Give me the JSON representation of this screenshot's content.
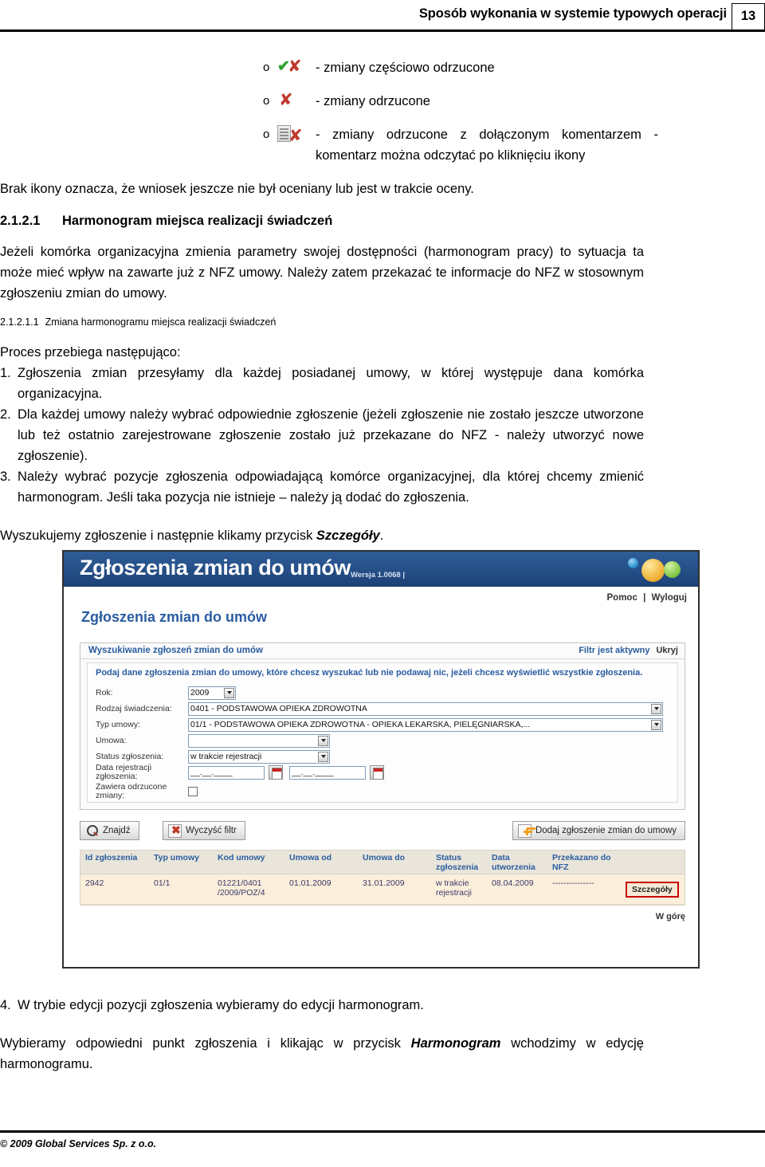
{
  "header": {
    "title": "Sposób wykonania w systemie typowych operacji",
    "page_number": "13"
  },
  "icon_list": [
    {
      "bullet": "o",
      "icon": "check-and-red-x-icon",
      "text": "- zmiany częściowo odrzucone"
    },
    {
      "bullet": "o",
      "icon": "red-x-icon",
      "text": "- zmiany odrzucone"
    },
    {
      "bullet": "o",
      "icon": "document-with-red-x-icon",
      "text": "- zmiany odrzucone z dołączonym komentarzem - komentarz można odczytać po kliknięciu ikony"
    }
  ],
  "note": "Brak ikony oznacza, że wniosek jeszcze nie był oceniany lub jest w trakcie oceny.",
  "section": {
    "number": "2.1.2.1",
    "title": "Harmonogram miejsca realizacji świadczeń",
    "paragraph": "Jeżeli komórka organizacyjna zmienia parametry swojej dostępności (harmonogram pracy) to sytuacja ta może mieć wpływ na zawarte już z NFZ umowy. Należy zatem przekazać te informacje do NFZ w stosownym zgłoszeniu zmian do umowy."
  },
  "subsection": {
    "number": "2.1.2.1.1",
    "title": "Zmiana harmonogramu miejsca realizacji świadczeń"
  },
  "process": {
    "intro": "Proces przebiega następująco:",
    "steps": [
      {
        "n": "1.",
        "text": "Zgłoszenia zmian przesyłamy dla każdej posiadanej umowy, w której występuje dana komórka organizacyjna."
      },
      {
        "n": "2.",
        "text": "Dla każdej umowy należy wybrać odpowiednie zgłoszenie (jeżeli zgłoszenie nie zostało jeszcze utworzone lub też ostatnio zarejestrowane zgłoszenie zostało już przekazane do NFZ  - należy utworzyć nowe zgłoszenie)."
      },
      {
        "n": "3.",
        "text": "Należy wybrać pozycje zgłoszenia odpowiadającą komórce organizacyjnej, dla której chcemy zmienić harmonogram. Jeśli taka pozycja nie istnieje – należy ją dodać do zgłoszenia."
      }
    ]
  },
  "lead_in": {
    "before": "Wyszukujemy zgłoszenie i następnie klikamy przycisk ",
    "emphasis": "Szczegóły",
    "after": "."
  },
  "screenshot": {
    "app_title": "Zgłoszenia zmian do umów",
    "version": "Wersja 1.0068 |",
    "top_links": {
      "help": "Pomoc",
      "separator": "|",
      "logout": "Wyloguj"
    },
    "page_title": "Zgłoszenia zmian do umów",
    "panel": {
      "title": "Wyszukiwanie zgłoszeń zmian do umów",
      "filter_status": "Filtr jest aktywny",
      "hide_label": "Ukryj",
      "hint": "Podaj dane zgłoszenia zmian do umowy, które chcesz wyszukać lub nie podawaj nic, jeżeli chcesz wyświetlić wszystkie zgłoszenia.",
      "fields": [
        {
          "label": "Rok:",
          "value": "2009"
        },
        {
          "label": "Rodzaj świadczenia:",
          "value": "0401 - PODSTAWOWA OPIEKA ZDROWOTNA"
        },
        {
          "label": "Typ umowy:",
          "value": "01/1 - PODSTAWOWA OPIEKA ZDROWOTNA - OPIEKA LEKARSKA, PIELĘGNIARSKA,..."
        },
        {
          "label": "Umowa:",
          "value": ""
        },
        {
          "label": "Status zgłoszenia:",
          "value": "w trakcie rejestracji"
        }
      ],
      "date_label_line1": "Data rejestracji",
      "date_label_line2": "zgłoszenia:",
      "date_from": "__.__.____",
      "date_to": "__.__.____",
      "checkbox_label_line1": "Zawiera odrzucone",
      "checkbox_label_line2": "zmiany:"
    },
    "buttons": {
      "find": "Znajdź",
      "clear_filter": "Wyczyść filtr",
      "add": "Dodaj zgłoszenie zmian do umowy"
    },
    "grid": {
      "columns": [
        "Id zgłoszenia",
        "Typ umowy",
        "Kod umowy",
        "Umowa od",
        "Umowa do",
        "Status zgłoszenia",
        "Data utworzenia",
        "Przekazano do NFZ",
        ""
      ],
      "rows": [
        {
          "id": "2942",
          "typ_umowy": "01/1",
          "kod_umowy": "01221/0401 /2009/POZ/4",
          "umowa_od": "01.01.2009",
          "umowa_do": "31.01.2009",
          "status": "w trakcie rejestracji",
          "data_utworzenia": "08.04.2009",
          "przekazano": "---------------",
          "action": "Szczegóły"
        }
      ],
      "footer_link": "W górę"
    }
  },
  "tail": {
    "step4": {
      "n": "4.",
      "text": "W trybie edycji pozycji zgłoszenia wybieramy do edycji harmonogram."
    },
    "closing": {
      "before": "Wybieramy odpowiedni punkt zgłoszenia i klikając w   przycisk ",
      "emphasis": "Harmonogram",
      "after": " wchodzimy w edycję harmonogramu."
    }
  },
  "footer": {
    "copyright": "© 2009 Global Services Sp. z o.o."
  }
}
